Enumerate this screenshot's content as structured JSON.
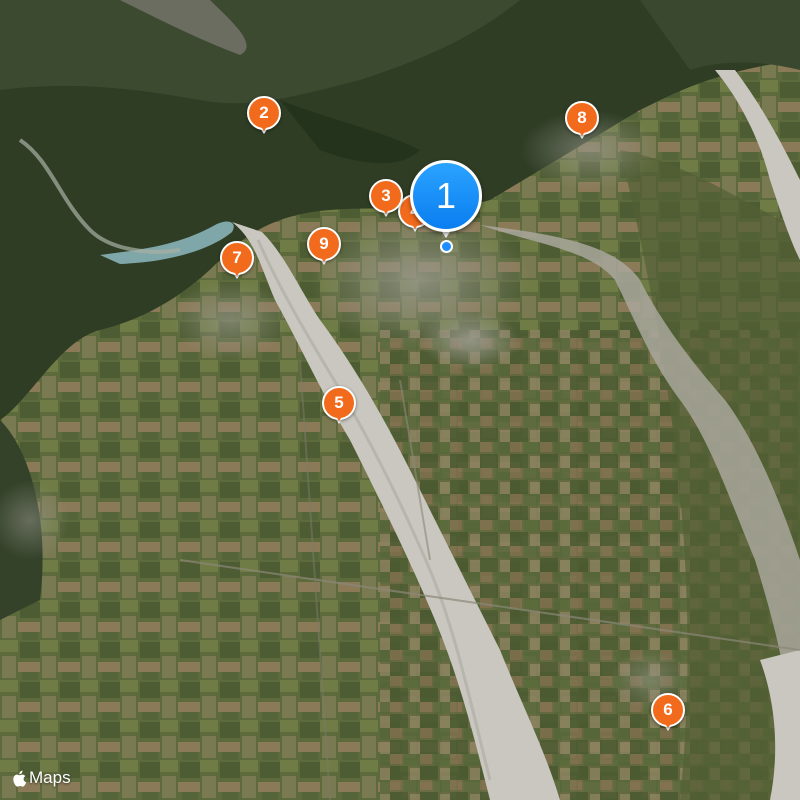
{
  "map": {
    "view": "satellite",
    "colors": {
      "pin": "#f26a1b",
      "pin_primary": "#0a7ef0",
      "river": "#c9c7c0",
      "lake": "#7fa6a8"
    }
  },
  "markers": [
    {
      "id": "m1",
      "label": "1",
      "primary": true
    },
    {
      "id": "m2",
      "label": "2"
    },
    {
      "id": "m3",
      "label": "3"
    },
    {
      "id": "m4",
      "label": "4",
      "occluded": true
    },
    {
      "id": "m5",
      "label": "5"
    },
    {
      "id": "m6",
      "label": "6"
    },
    {
      "id": "m7",
      "label": "7"
    },
    {
      "id": "m8",
      "label": "8"
    },
    {
      "id": "m9",
      "label": "9"
    }
  ],
  "attribution": {
    "logo_icon": "apple-logo-icon",
    "text": "Maps"
  }
}
